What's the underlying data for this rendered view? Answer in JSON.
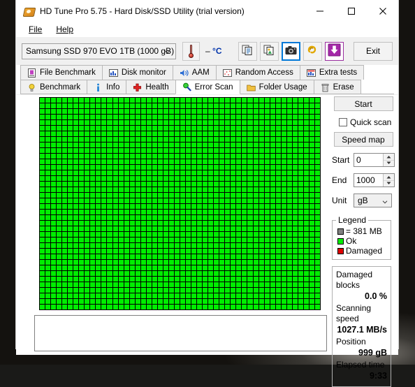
{
  "window": {
    "title": "HD Tune Pro 5.75 - Hard Disk/SSD Utility (trial version)",
    "icon": "hard-disk-icon",
    "minimize_label": "minimize",
    "maximize_label": "maximize",
    "close_label": "close"
  },
  "menu": {
    "items": [
      {
        "label": "File",
        "accel": "F"
      },
      {
        "label": "Help",
        "accel": "H"
      }
    ]
  },
  "toolbar": {
    "drive_selected": "Samsung SSD 970 EVO 1TB (1000 gB)",
    "temperature": "– °C",
    "temp_value": "–",
    "temp_unit": "°C",
    "buttons": [
      {
        "name": "copy-text-icon",
        "tooltip": "Copy text"
      },
      {
        "name": "copy-image-icon",
        "tooltip": "Copy screenshot"
      },
      {
        "name": "camera-icon",
        "tooltip": "Save screenshot",
        "focused": true
      },
      {
        "name": "clip-icon",
        "tooltip": "Options"
      },
      {
        "name": "download-icon",
        "tooltip": "Download"
      }
    ],
    "exit_label": "Exit"
  },
  "tabs": {
    "row1": [
      {
        "label": "File Benchmark",
        "icon": "file-benchmark-icon",
        "active": false
      },
      {
        "label": "Disk monitor",
        "icon": "disk-monitor-icon",
        "active": false
      },
      {
        "label": "AAM",
        "icon": "speaker-icon",
        "active": false
      },
      {
        "label": "Random Access",
        "icon": "random-access-icon",
        "active": false
      },
      {
        "label": "Extra tests",
        "icon": "extra-tests-icon",
        "active": false
      }
    ],
    "row2": [
      {
        "label": "Benchmark",
        "icon": "lightbulb-icon",
        "active": false
      },
      {
        "label": "Info",
        "icon": "info-icon",
        "active": false
      },
      {
        "label": "Health",
        "icon": "health-cross-icon",
        "active": false
      },
      {
        "label": "Error Scan",
        "icon": "magnifier-icon",
        "active": true
      },
      {
        "label": "Folder Usage",
        "icon": "folder-icon",
        "active": false
      },
      {
        "label": "Erase",
        "icon": "trash-icon",
        "active": false
      }
    ]
  },
  "controls": {
    "start_label": "Start",
    "quick_scan_label": "Quick scan",
    "quick_scan_checked": false,
    "speed_map_label": "Speed map",
    "start_field_label": "Start",
    "start_field_value": "0",
    "end_field_label": "End",
    "end_field_value": "1000",
    "unit_label": "Unit",
    "unit_value": "gB"
  },
  "legend": {
    "title": "Legend",
    "block_size": "= 381 MB",
    "block_color": "#808080",
    "ok_label": "Ok",
    "ok_color": "#00ee00",
    "damaged_label": "Damaged",
    "damaged_color": "#e00000"
  },
  "stats": {
    "damaged_blocks_label": "Damaged blocks",
    "damaged_blocks_value": "0.0 %",
    "scanning_speed_label": "Scanning speed",
    "scanning_speed_value": "1027.1 MB/s",
    "position_label": "Position",
    "position_value": "999 gB",
    "elapsed_time_label": "Elapsed time",
    "elapsed_time_value": "9:33"
  },
  "scan_grid": {
    "columns": 50,
    "rows": 38,
    "all_ok": true,
    "log_text": ""
  }
}
